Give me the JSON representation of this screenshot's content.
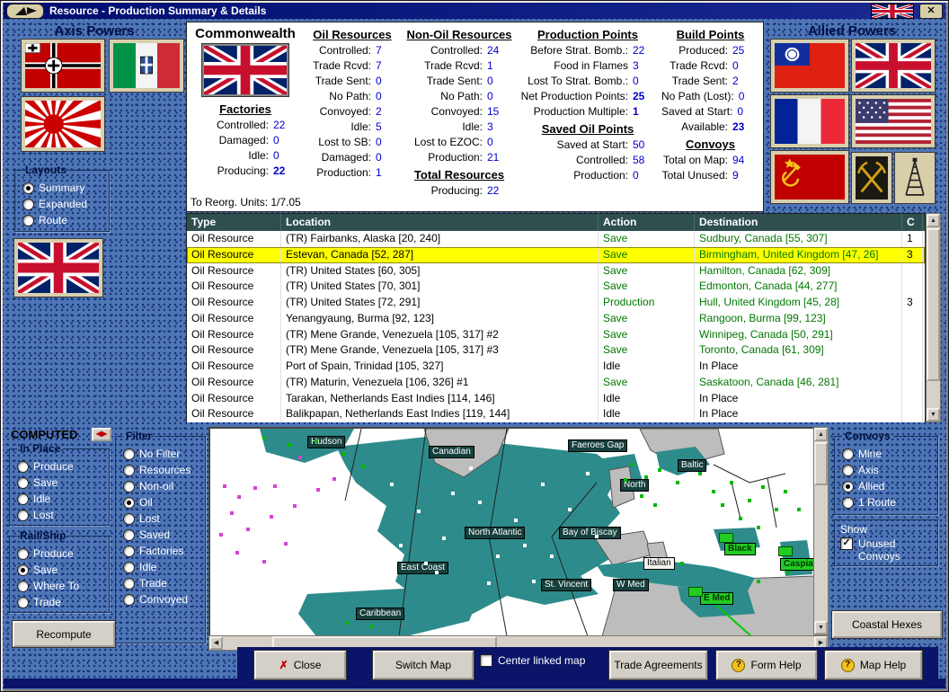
{
  "window": {
    "title": "Resource - Production Summary & Details",
    "close_glyph": "✕"
  },
  "axis": {
    "title": "Axis Powers"
  },
  "allied": {
    "title": "Allied Powers"
  },
  "layouts": {
    "caption": "Layouts",
    "items": [
      {
        "label": "Summary",
        "on": true
      },
      {
        "label": "Expanded",
        "on": false
      },
      {
        "label": "Route",
        "on": false
      }
    ]
  },
  "summary": {
    "columns": [
      {
        "name": "commonwealth",
        "title": "Commonwealth",
        "flag": "uk",
        "sections": [
          {
            "heading": "Factories",
            "rows": [
              [
                "Controlled:",
                "22",
                false
              ],
              [
                "Damaged:",
                "0",
                false
              ],
              [
                "Idle:",
                "0",
                false
              ],
              [
                "Producing:",
                "22",
                true
              ]
            ]
          }
        ],
        "footer": "To Reorg. Units: 1/7.05"
      },
      {
        "name": "oil-resources",
        "sections": [
          {
            "heading": "Oil Resources",
            "rows": [
              [
                "Controlled:",
                "7",
                false
              ],
              [
                "Trade Rcvd:",
                "7",
                false
              ],
              [
                "Trade Sent:",
                "0",
                false
              ],
              [
                "No Path:",
                "0",
                false
              ],
              [
                "Convoyed:",
                "2",
                false
              ],
              [
                "Idle:",
                "5",
                false
              ],
              [
                "Lost to SB:",
                "0",
                false
              ],
              [
                "Damaged:",
                "0",
                false
              ],
              [
                "Production:",
                "1",
                false
              ]
            ]
          }
        ]
      },
      {
        "name": "non-oil-resources",
        "sections": [
          {
            "heading": "Non-Oil Resources",
            "rows": [
              [
                "Controlled:",
                "24",
                false
              ],
              [
                "Trade Rcvd:",
                "1",
                false
              ],
              [
                "Trade Sent:",
                "0",
                false
              ],
              [
                "No Path:",
                "0",
                false
              ],
              [
                "Convoyed:",
                "15",
                false
              ],
              [
                "Idle:",
                "3",
                false
              ],
              [
                "Lost to EZOC:",
                "0",
                false
              ],
              [
                "Production:",
                "21",
                false
              ]
            ]
          },
          {
            "heading": "Total Resources",
            "rows": [
              [
                "Producing:",
                "22",
                false
              ]
            ]
          }
        ]
      },
      {
        "name": "production-points",
        "sections": [
          {
            "heading": "Production Points",
            "rows": [
              [
                "Before Strat. Bomb.:",
                "22",
                false
              ],
              [
                "Food in Flames",
                "3",
                false
              ],
              [
                "Lost To Strat. Bomb.:",
                "0",
                false
              ],
              [
                "Net Production Points:",
                "25",
                true
              ],
              [
                "Production Multiple:",
                "1",
                true
              ]
            ]
          },
          {
            "heading": "Saved Oil Points",
            "rows": [
              [
                "Saved at Start:",
                "50",
                false
              ],
              [
                "Controlled:",
                "58",
                false
              ],
              [
                "Production:",
                "0",
                false
              ]
            ]
          }
        ]
      },
      {
        "name": "build-points",
        "sections": [
          {
            "heading": "Build Points",
            "rows": [
              [
                "Produced:",
                "25",
                false
              ],
              [
                "Trade Rcvd:",
                "0",
                false
              ],
              [
                "Trade Sent:",
                "2",
                false
              ],
              [
                "No Path (Lost):",
                "0",
                false
              ],
              [
                "Saved at Start:",
                "0",
                false
              ],
              [
                "Available:",
                "23",
                true
              ]
            ]
          },
          {
            "heading": "Convoys",
            "rows": [
              [
                "Total on Map:",
                "94",
                false
              ],
              [
                "Total Unused:",
                "9",
                false
              ]
            ]
          }
        ]
      }
    ]
  },
  "table": {
    "headers": [
      "Type",
      "Location",
      "Action",
      "Destination",
      "C"
    ],
    "rows": [
      {
        "type": "Oil Resource",
        "location": "(TR) Fairbanks, Alaska [20, 240]",
        "action": "Save",
        "destination": "Sudbury, Canada [55, 307]",
        "c": "1",
        "selected": false
      },
      {
        "type": "Oil Resource",
        "location": "Estevan, Canada [52, 287]",
        "action": "Save",
        "destination": "Birmingham, United Kingdom [47, 26]",
        "c": "3",
        "selected": true
      },
      {
        "type": "Oil Resource",
        "location": "(TR) United States [60, 305]",
        "action": "Save",
        "destination": "Hamilton, Canada [62, 309]",
        "c": "",
        "selected": false
      },
      {
        "type": "Oil Resource",
        "location": "(TR) United States [70, 301]",
        "action": "Save",
        "destination": "Edmonton, Canada [44, 277]",
        "c": "",
        "selected": false
      },
      {
        "type": "Oil Resource",
        "location": "(TR) United States [72, 291]",
        "action": "Production",
        "destination": "Hull, United Kingdom [45, 28]",
        "c": "3",
        "selected": false
      },
      {
        "type": "Oil Resource",
        "location": "Yenangyaung, Burma [92, 123]",
        "action": "Save",
        "destination": "Rangoon, Burma [99, 123]",
        "c": "",
        "selected": false
      },
      {
        "type": "Oil Resource",
        "location": "(TR) Mene Grande, Venezuela [105, 317] #2",
        "action": "Save",
        "destination": "Winnipeg, Canada [50, 291]",
        "c": "",
        "selected": false
      },
      {
        "type": "Oil Resource",
        "location": "(TR) Mene Grande, Venezuela [105, 317] #3",
        "action": "Save",
        "destination": "Toronto, Canada [61, 309]",
        "c": "",
        "selected": false
      },
      {
        "type": "Oil Resource",
        "location": "Port of Spain, Trinidad [105, 327]",
        "action": "Idle",
        "destination": "In Place",
        "c": "",
        "selected": false
      },
      {
        "type": "Oil Resource",
        "location": "(TR) Maturin, Venezuela [106, 326] #1",
        "action": "Save",
        "destination": "Saskatoon, Canada [46, 281]",
        "c": "",
        "selected": false
      },
      {
        "type": "Oil Resource",
        "location": "Tarakan, Netherlands East Indies [114, 146]",
        "action": "Idle",
        "destination": "In Place",
        "c": "",
        "selected": false
      },
      {
        "type": "Oil Resource",
        "location": "Balikpapan, Netherlands East Indies [119, 144]",
        "action": "Idle",
        "destination": "In Place",
        "c": "",
        "selected": false
      }
    ]
  },
  "computed": {
    "label": "COMPUTED"
  },
  "in_place": {
    "caption": "In Place",
    "items": [
      {
        "label": "Produce",
        "on": false
      },
      {
        "label": "Save",
        "on": false
      },
      {
        "label": "Idle",
        "on": false
      },
      {
        "label": "Lost",
        "on": false
      }
    ]
  },
  "rail_ship": {
    "caption": "Rail/Ship",
    "items": [
      {
        "label": "Produce",
        "on": false
      },
      {
        "label": "Save",
        "on": true
      },
      {
        "label": "Where To",
        "on": false
      },
      {
        "label": "Trade",
        "on": false
      }
    ]
  },
  "filter": {
    "caption": "Filter",
    "items": [
      {
        "label": "No Filter",
        "on": false
      },
      {
        "label": "Resources",
        "on": false
      },
      {
        "label": "Non-oil",
        "on": false
      },
      {
        "label": "Oil",
        "on": true
      },
      {
        "label": "Lost",
        "on": false
      },
      {
        "label": "Saved",
        "on": false
      },
      {
        "label": "Factories",
        "on": false
      },
      {
        "label": "Idle",
        "on": false
      },
      {
        "label": "Trade",
        "on": false
      },
      {
        "label": "Convoyed",
        "on": false
      }
    ]
  },
  "convoys_box": {
    "caption": "Convoys",
    "items": [
      {
        "label": "Mine",
        "on": false
      },
      {
        "label": "Axis",
        "on": false
      },
      {
        "label": "Allied",
        "on": true
      },
      {
        "label": "1 Route",
        "on": false
      }
    ]
  },
  "show_box": {
    "title": "Show",
    "label": "Unused Convoys",
    "checked": true
  },
  "buttons": {
    "recompute": "Recompute",
    "coastal_hexes": "Coastal Hexes",
    "close": "Close",
    "switch_map": "Switch Map",
    "center_linked": "Center linked map",
    "trade_agreements": "Trade Agreements",
    "form_help": "Form Help",
    "map_help": "Map Help"
  },
  "colors": {
    "accent_green": "#007800",
    "value_blue": "#0000cc",
    "selected_yellow": "#ffff00",
    "sea_teal": "#2e8b8b"
  },
  "icons": {
    "titlebar": "ship-pennant-icon",
    "mine_button": "pick-and-hammer-icon",
    "derrick_button": "oil-derrick-icon"
  },
  "map": {
    "labels": [
      [
        "Hudson",
        108,
        8,
        "d"
      ],
      [
        "Canadian",
        243,
        19,
        "d"
      ],
      [
        "Faeroes Gap",
        398,
        12,
        "d"
      ],
      [
        "Baltic",
        520,
        34,
        "d"
      ],
      [
        "North",
        456,
        56,
        "d"
      ],
      [
        "North Atlantic",
        283,
        109,
        "d"
      ],
      [
        "Bay of Biscay",
        388,
        109,
        "d"
      ],
      [
        "East Coast",
        208,
        148,
        "d"
      ],
      [
        "St. Vincent",
        368,
        167,
        "d"
      ],
      [
        "W Med",
        448,
        167,
        "d"
      ],
      [
        "Caribbean",
        162,
        199,
        "d"
      ],
      [
        "Italian",
        482,
        143,
        "l"
      ],
      [
        "Black",
        572,
        127,
        "g"
      ],
      [
        "Caspian",
        634,
        144,
        "g"
      ],
      [
        "E Med",
        545,
        182,
        "g"
      ]
    ],
    "dots": [
      [
        "m",
        14,
        62
      ],
      [
        "m",
        30,
        74
      ],
      [
        "m",
        22,
        92
      ],
      [
        "m",
        48,
        64
      ],
      [
        "m",
        66,
        96
      ],
      [
        "m",
        92,
        84
      ],
      [
        "m",
        118,
        66
      ],
      [
        "m",
        28,
        136
      ],
      [
        "m",
        58,
        146
      ],
      [
        "m",
        10,
        116
      ],
      [
        "m",
        82,
        126
      ],
      [
        "m",
        136,
        54
      ],
      [
        "m",
        98,
        30
      ],
      [
        "m",
        40,
        110
      ],
      [
        "m",
        70,
        62
      ],
      [
        "g",
        86,
        16
      ],
      [
        "g",
        116,
        12
      ],
      [
        "g",
        58,
        8
      ],
      [
        "g",
        146,
        26
      ],
      [
        "g",
        168,
        40
      ],
      [
        "g",
        150,
        214
      ],
      [
        "g",
        178,
        218
      ],
      [
        "g",
        468,
        38
      ],
      [
        "g",
        483,
        52
      ],
      [
        "g",
        498,
        44
      ],
      [
        "g",
        518,
        58
      ],
      [
        "g",
        543,
        48
      ],
      [
        "g",
        558,
        68
      ],
      [
        "g",
        578,
        58
      ],
      [
        "g",
        598,
        78
      ],
      [
        "g",
        613,
        63
      ],
      [
        "g",
        628,
        88
      ],
      [
        "g",
        588,
        98
      ],
      [
        "g",
        608,
        108
      ],
      [
        "g",
        638,
        68
      ],
      [
        "g",
        653,
        88
      ],
      [
        "g",
        568,
        83
      ],
      [
        "g",
        478,
        73
      ],
      [
        "g",
        493,
        83
      ],
      [
        "g",
        523,
        148
      ],
      [
        "g",
        608,
        168
      ],
      [
        "g",
        641,
        158
      ],
      [
        "g",
        460,
        55
      ],
      [
        "w",
        200,
        60
      ],
      [
        "w",
        230,
        90
      ],
      [
        "w",
        258,
        120
      ],
      [
        "w",
        298,
        80
      ],
      [
        "w",
        338,
        100
      ],
      [
        "w",
        318,
        140
      ],
      [
        "w",
        250,
        158
      ],
      [
        "w",
        210,
        128
      ],
      [
        "w",
        368,
        60
      ],
      [
        "w",
        398,
        88
      ],
      [
        "w",
        428,
        118
      ],
      [
        "w",
        358,
        168
      ],
      [
        "w",
        288,
        42
      ],
      [
        "w",
        182,
        100
      ],
      [
        "w",
        418,
        48
      ],
      [
        "w",
        348,
        128
      ],
      [
        "w",
        268,
        70
      ],
      [
        "w",
        238,
        148
      ],
      [
        "w",
        308,
        170
      ],
      [
        "w",
        378,
        140
      ]
    ],
    "chips": [
      [
        566,
        116
      ],
      [
        632,
        131
      ],
      [
        532,
        176
      ]
    ]
  }
}
